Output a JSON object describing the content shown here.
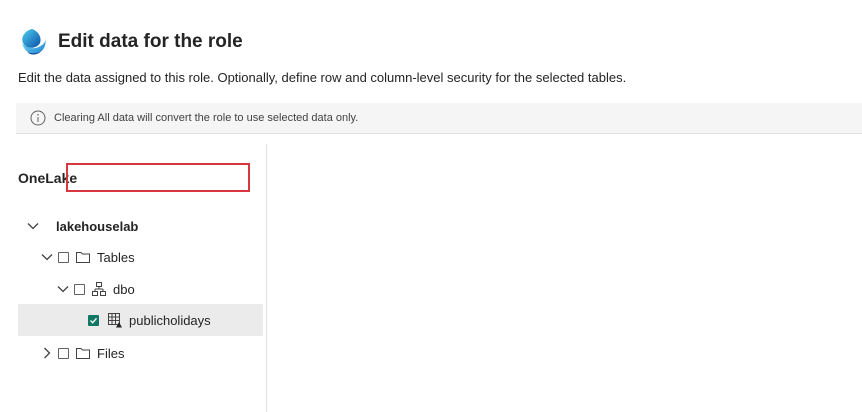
{
  "header": {
    "title": "Edit data for the role",
    "logo_icon": "fabric-logo-icon"
  },
  "subtitle": "Edit the data assigned to this role. Optionally, define row and column-level security for the selected tables.",
  "banner": {
    "icon": "info-icon",
    "text": "Clearing All data will convert the role to use selected data only."
  },
  "tree": {
    "section_label": "OneLake",
    "items": [
      {
        "label": "lakehouselab",
        "expanded": true,
        "checked": false
      },
      {
        "label": "Tables",
        "expanded": true,
        "checked": false
      },
      {
        "label": "dbo",
        "expanded": true,
        "checked": false
      },
      {
        "label": "publicholidays",
        "checked": true,
        "selected": true
      },
      {
        "label": "Files",
        "expanded": false,
        "checked": false
      }
    ]
  },
  "colors": {
    "accent": "#117865",
    "highlight_border": "#d9373f"
  }
}
